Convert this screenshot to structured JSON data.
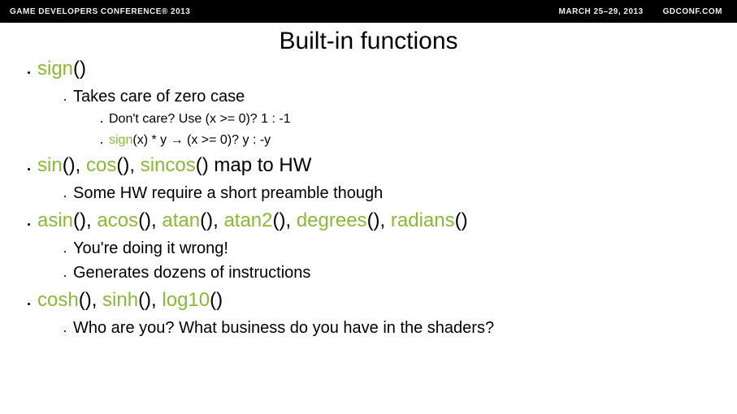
{
  "header": {
    "left": "GAME DEVELOPERS CONFERENCE® 2013",
    "date": "MARCH 25–29, 2013",
    "site": "GDCONF.COM"
  },
  "slide": {
    "title": "Built-in functions",
    "b1": {
      "fn": "sign",
      "s1": "Takes care of zero case",
      "s1a": "Don't care? Use (x >= 0)? 1 : -1",
      "s1b_fn": "sign",
      "s1b_rest": "(x) * y → (x >= 0)? y : -y"
    },
    "b2": {
      "fn1": "sin",
      "fn2": "cos",
      "fn3": "sincos",
      "rest": " map to HW",
      "s1": "Some HW require a short preamble though"
    },
    "b3": {
      "fn1": "asin",
      "fn2": "acos",
      "fn3": "atan",
      "fn4": "atan2",
      "fn5": "degrees",
      "fn6": "radians",
      "s1": "You're doing it wrong!",
      "s2": "Generates dozens of instructions"
    },
    "b4": {
      "fn1": "cosh",
      "fn2": "sinh",
      "fn3": "log10",
      "s1": "Who are you? What business do you have in the shaders?"
    }
  }
}
